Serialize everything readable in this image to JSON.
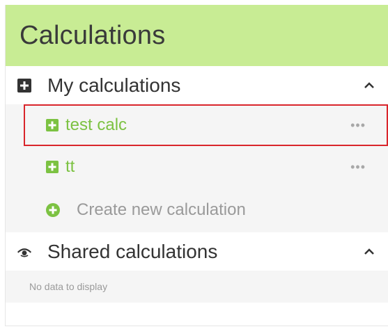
{
  "header": {
    "title": "Calculations"
  },
  "my_calculations": {
    "label": "My calculations",
    "items": [
      {
        "label": "test calc",
        "menu": "•••"
      },
      {
        "label": "tt",
        "menu": "•••"
      }
    ],
    "create_label": "Create new calculation"
  },
  "shared_calculations": {
    "label": "Shared calculations",
    "empty_text": "No data to display"
  },
  "colors": {
    "header_bg": "#c8ec94",
    "accent_green": "#7cc242",
    "selection_outline": "#d9252b"
  }
}
